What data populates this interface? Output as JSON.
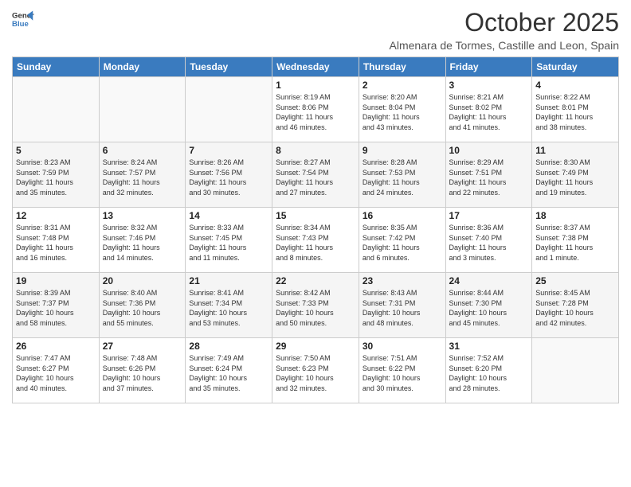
{
  "logo": {
    "line1": "General",
    "line2": "Blue"
  },
  "header": {
    "month": "October 2025",
    "location": "Almenara de Tormes, Castille and Leon, Spain"
  },
  "weekdays": [
    "Sunday",
    "Monday",
    "Tuesday",
    "Wednesday",
    "Thursday",
    "Friday",
    "Saturday"
  ],
  "weeks": [
    [
      {
        "day": "",
        "info": ""
      },
      {
        "day": "",
        "info": ""
      },
      {
        "day": "",
        "info": ""
      },
      {
        "day": "1",
        "info": "Sunrise: 8:19 AM\nSunset: 8:06 PM\nDaylight: 11 hours\nand 46 minutes."
      },
      {
        "day": "2",
        "info": "Sunrise: 8:20 AM\nSunset: 8:04 PM\nDaylight: 11 hours\nand 43 minutes."
      },
      {
        "day": "3",
        "info": "Sunrise: 8:21 AM\nSunset: 8:02 PM\nDaylight: 11 hours\nand 41 minutes."
      },
      {
        "day": "4",
        "info": "Sunrise: 8:22 AM\nSunset: 8:01 PM\nDaylight: 11 hours\nand 38 minutes."
      }
    ],
    [
      {
        "day": "5",
        "info": "Sunrise: 8:23 AM\nSunset: 7:59 PM\nDaylight: 11 hours\nand 35 minutes."
      },
      {
        "day": "6",
        "info": "Sunrise: 8:24 AM\nSunset: 7:57 PM\nDaylight: 11 hours\nand 32 minutes."
      },
      {
        "day": "7",
        "info": "Sunrise: 8:26 AM\nSunset: 7:56 PM\nDaylight: 11 hours\nand 30 minutes."
      },
      {
        "day": "8",
        "info": "Sunrise: 8:27 AM\nSunset: 7:54 PM\nDaylight: 11 hours\nand 27 minutes."
      },
      {
        "day": "9",
        "info": "Sunrise: 8:28 AM\nSunset: 7:53 PM\nDaylight: 11 hours\nand 24 minutes."
      },
      {
        "day": "10",
        "info": "Sunrise: 8:29 AM\nSunset: 7:51 PM\nDaylight: 11 hours\nand 22 minutes."
      },
      {
        "day": "11",
        "info": "Sunrise: 8:30 AM\nSunset: 7:49 PM\nDaylight: 11 hours\nand 19 minutes."
      }
    ],
    [
      {
        "day": "12",
        "info": "Sunrise: 8:31 AM\nSunset: 7:48 PM\nDaylight: 11 hours\nand 16 minutes."
      },
      {
        "day": "13",
        "info": "Sunrise: 8:32 AM\nSunset: 7:46 PM\nDaylight: 11 hours\nand 14 minutes."
      },
      {
        "day": "14",
        "info": "Sunrise: 8:33 AM\nSunset: 7:45 PM\nDaylight: 11 hours\nand 11 minutes."
      },
      {
        "day": "15",
        "info": "Sunrise: 8:34 AM\nSunset: 7:43 PM\nDaylight: 11 hours\nand 8 minutes."
      },
      {
        "day": "16",
        "info": "Sunrise: 8:35 AM\nSunset: 7:42 PM\nDaylight: 11 hours\nand 6 minutes."
      },
      {
        "day": "17",
        "info": "Sunrise: 8:36 AM\nSunset: 7:40 PM\nDaylight: 11 hours\nand 3 minutes."
      },
      {
        "day": "18",
        "info": "Sunrise: 8:37 AM\nSunset: 7:38 PM\nDaylight: 11 hours\nand 1 minute."
      }
    ],
    [
      {
        "day": "19",
        "info": "Sunrise: 8:39 AM\nSunset: 7:37 PM\nDaylight: 10 hours\nand 58 minutes."
      },
      {
        "day": "20",
        "info": "Sunrise: 8:40 AM\nSunset: 7:36 PM\nDaylight: 10 hours\nand 55 minutes."
      },
      {
        "day": "21",
        "info": "Sunrise: 8:41 AM\nSunset: 7:34 PM\nDaylight: 10 hours\nand 53 minutes."
      },
      {
        "day": "22",
        "info": "Sunrise: 8:42 AM\nSunset: 7:33 PM\nDaylight: 10 hours\nand 50 minutes."
      },
      {
        "day": "23",
        "info": "Sunrise: 8:43 AM\nSunset: 7:31 PM\nDaylight: 10 hours\nand 48 minutes."
      },
      {
        "day": "24",
        "info": "Sunrise: 8:44 AM\nSunset: 7:30 PM\nDaylight: 10 hours\nand 45 minutes."
      },
      {
        "day": "25",
        "info": "Sunrise: 8:45 AM\nSunset: 7:28 PM\nDaylight: 10 hours\nand 42 minutes."
      }
    ],
    [
      {
        "day": "26",
        "info": "Sunrise: 7:47 AM\nSunset: 6:27 PM\nDaylight: 10 hours\nand 40 minutes."
      },
      {
        "day": "27",
        "info": "Sunrise: 7:48 AM\nSunset: 6:26 PM\nDaylight: 10 hours\nand 37 minutes."
      },
      {
        "day": "28",
        "info": "Sunrise: 7:49 AM\nSunset: 6:24 PM\nDaylight: 10 hours\nand 35 minutes."
      },
      {
        "day": "29",
        "info": "Sunrise: 7:50 AM\nSunset: 6:23 PM\nDaylight: 10 hours\nand 32 minutes."
      },
      {
        "day": "30",
        "info": "Sunrise: 7:51 AM\nSunset: 6:22 PM\nDaylight: 10 hours\nand 30 minutes."
      },
      {
        "day": "31",
        "info": "Sunrise: 7:52 AM\nSunset: 6:20 PM\nDaylight: 10 hours\nand 28 minutes."
      },
      {
        "day": "",
        "info": ""
      }
    ]
  ]
}
